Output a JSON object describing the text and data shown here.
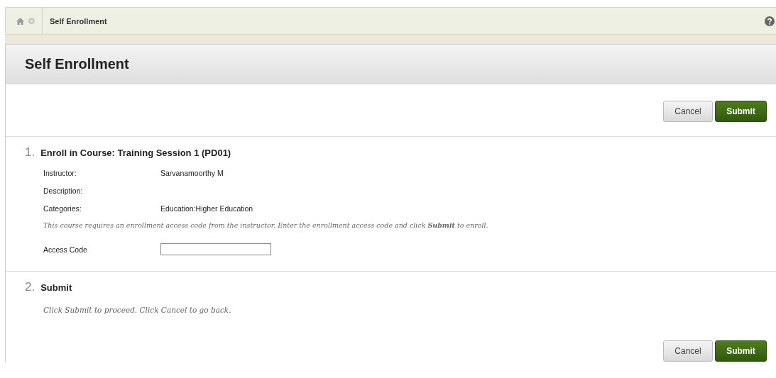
{
  "breadcrumb": {
    "current": "Self Enrollment"
  },
  "page_title": "Self Enrollment",
  "top_buttons": [
    {
      "label": "Cancel",
      "kind": "secondary"
    },
    {
      "label": "Submit",
      "kind": "primary"
    }
  ],
  "steps": [
    {
      "number": "1.",
      "title": "Enroll in Course: Training Session 1 (PD01)",
      "fields": [
        {
          "label": "Instructor:",
          "value": "Sarvanamoorthy M"
        },
        {
          "label": "Description:"
        },
        {
          "label": "Categories:",
          "value": "Education:Higher Education"
        }
      ],
      "instructions": "This course requires an enrollment access code from the instructor. Enter the enrollment access code and click **Submit** to enroll.",
      "input": {
        "label": "Access Code"
      }
    },
    {
      "number": "2.",
      "title": "Submit",
      "instructions": "Click Submit to proceed. Click Cancel to go back."
    }
  ],
  "bottom_buttons": [
    {
      "label": "Cancel",
      "kind": "secondary"
    },
    {
      "label": "Submit",
      "kind": "primary"
    }
  ]
}
